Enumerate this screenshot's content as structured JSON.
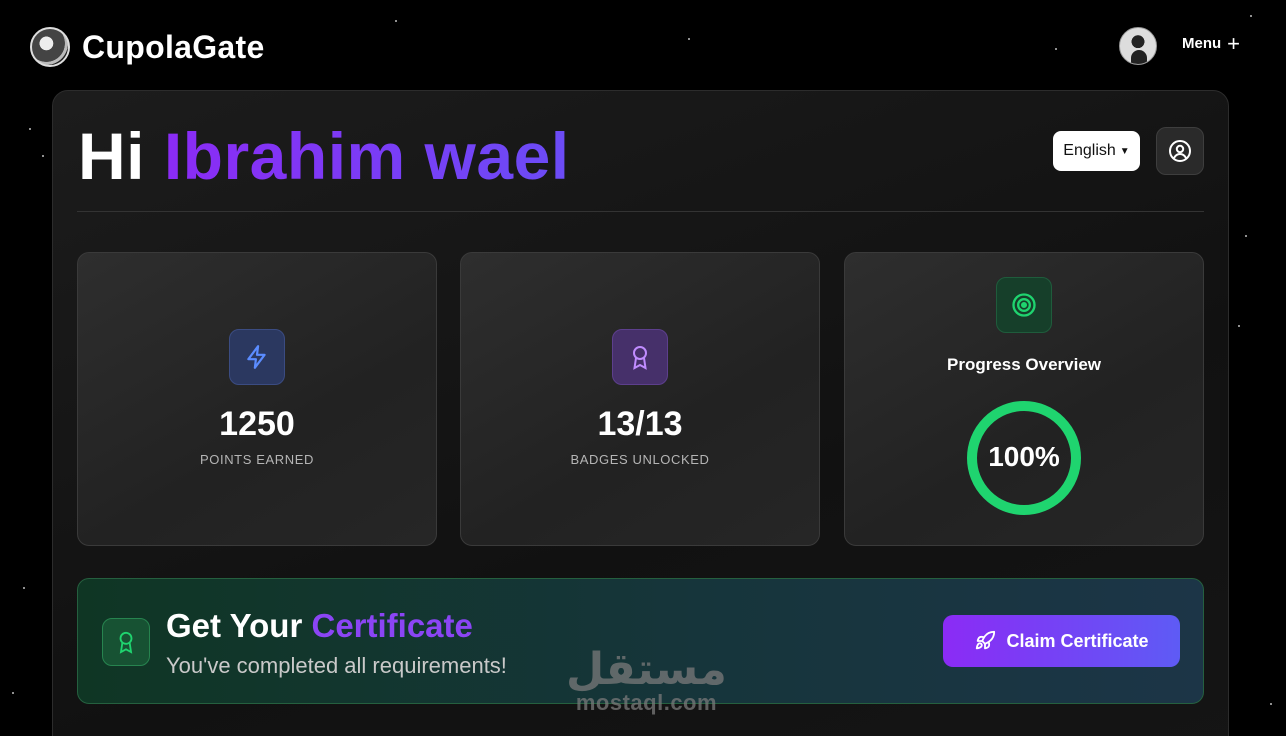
{
  "header": {
    "brand": "CupolaGate",
    "menu_label": "Menu"
  },
  "greeting": {
    "hi": "Hi",
    "name": "Ibrahim wael"
  },
  "language": {
    "selected": "English"
  },
  "stats": [
    {
      "value": "1250",
      "label": "POINTS EARNED",
      "icon": "lightning-icon"
    },
    {
      "value": "13/13",
      "label": "BADGES UNLOCKED",
      "icon": "badge-icon"
    }
  ],
  "progress": {
    "title": "Progress Overview",
    "percent_text": "100%",
    "percent": 100,
    "ring_color": "#1fd46f"
  },
  "certificate": {
    "title_plain": "Get Your",
    "title_accent": "Certificate",
    "subtitle": "You've completed all requirements!",
    "button": "Claim Certificate"
  },
  "watermark": {
    "arabic": "مستقل",
    "latin": "mostaql.com"
  },
  "colors": {
    "accent_purple": "#8b2bf5",
    "accent_green": "#1fd46f"
  }
}
